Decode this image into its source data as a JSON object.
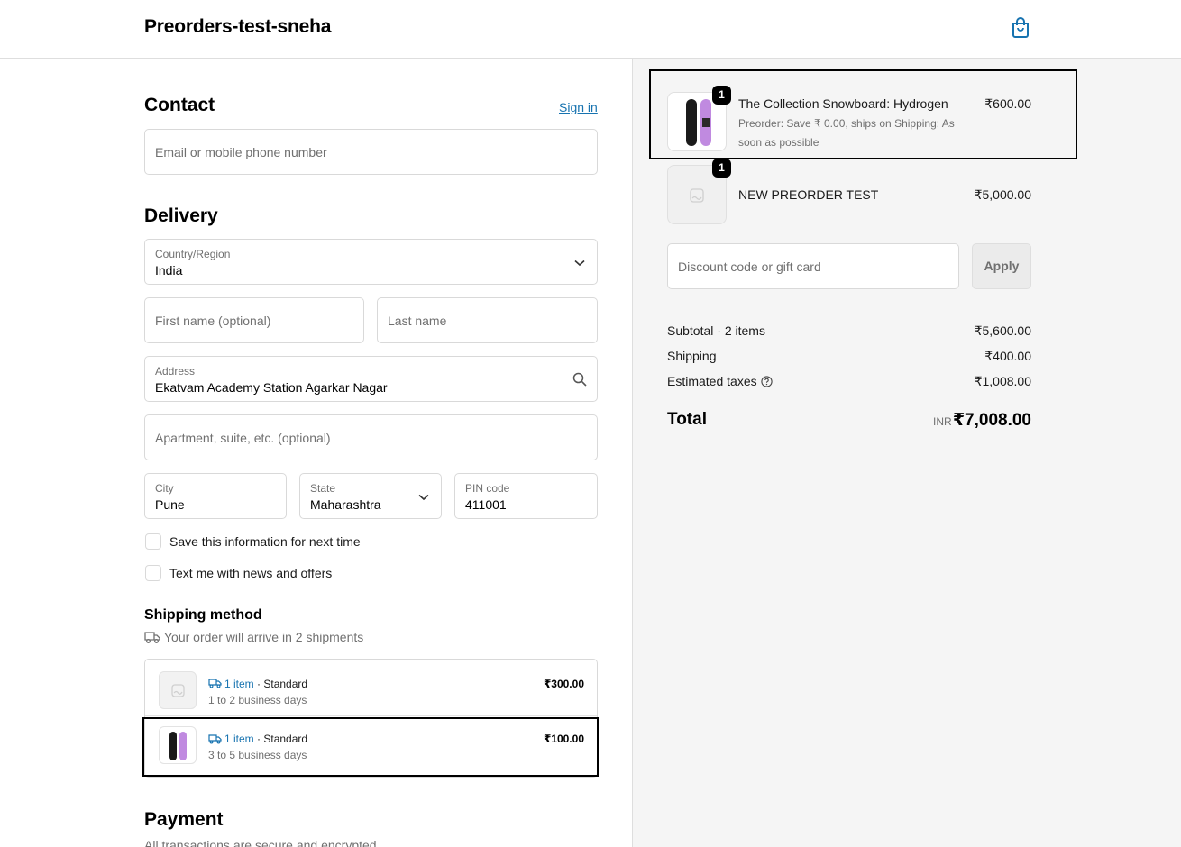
{
  "header": {
    "shop_name": "Preorders-test-sneha",
    "cart_icon": "shopping-bag-icon"
  },
  "contact": {
    "title": "Contact",
    "sign_in": "Sign in",
    "email_placeholder": "Email or mobile phone number"
  },
  "delivery": {
    "title": "Delivery",
    "country_label": "Country/Region",
    "country_value": "India",
    "first_name_placeholder": "First name (optional)",
    "last_name_placeholder": "Last name",
    "address_label": "Address",
    "address_value": "Ekatvam Academy Station Agarkar Nagar",
    "apartment_placeholder": "Apartment, suite, etc. (optional)",
    "city_label": "City",
    "city_value": "Pune",
    "state_label": "State",
    "state_value": "Maharashtra",
    "pin_label": "PIN code",
    "pin_value": "411001",
    "save_info": "Save this information for next time",
    "text_me": "Text me with news and offers"
  },
  "shipping": {
    "title": "Shipping method",
    "note": "Your order will arrive in 2 shipments",
    "rows": [
      {
        "items": "1 item",
        "sep": " · ",
        "method": "Standard",
        "days": "1 to 2 business days",
        "price": "₹300.00"
      },
      {
        "items": "1 item",
        "sep": " · ",
        "method": "Standard",
        "days": "3 to 5 business days",
        "price": "₹100.00"
      }
    ]
  },
  "payment": {
    "title": "Payment",
    "note": "All transactions are secure and encrypted."
  },
  "order": {
    "products": [
      {
        "qty": "1",
        "title": "The Collection Snowboard: Hydrogen",
        "subtitle": "Preorder: Save ₹ 0.00, ships on Shipping: As soon as possible",
        "price": "₹600.00"
      },
      {
        "qty": "1",
        "title": "NEW PREORDER TEST",
        "price": "₹5,000.00"
      }
    ],
    "discount_placeholder": "Discount code or gift card",
    "apply": "Apply",
    "subtotal_label": "Subtotal · 2 items",
    "subtotal": "₹5,600.00",
    "shipping_label": "Shipping",
    "shipping": "₹400.00",
    "taxes_label": "Estimated taxes",
    "taxes": "₹1,008.00",
    "total_label": "Total",
    "currency": "INR",
    "total": "₹7,008.00"
  }
}
